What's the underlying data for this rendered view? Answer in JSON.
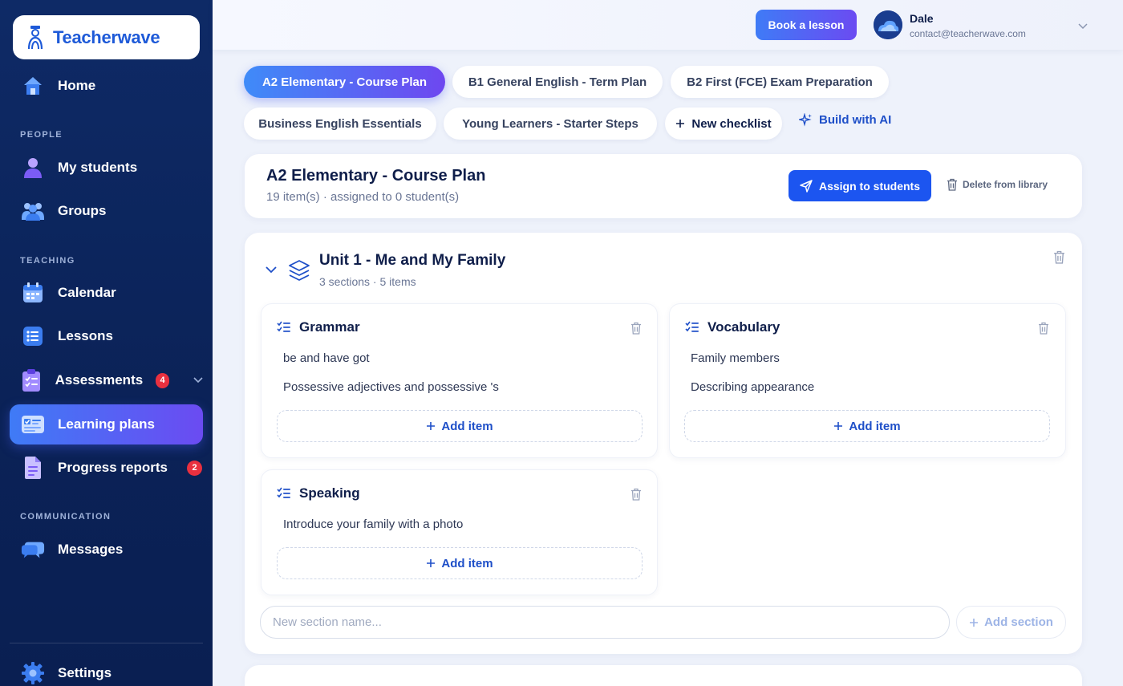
{
  "brand": {
    "name": "Teacherwave"
  },
  "sidebar": {
    "home": "Home",
    "sections": {
      "people": "PEOPLE",
      "teaching": "TEACHING",
      "communication": "COMMUNICATION"
    },
    "items": [
      {
        "label": "My students"
      },
      {
        "label": "Groups"
      },
      {
        "label": "Calendar"
      },
      {
        "label": "Lessons"
      },
      {
        "label": "Assessments",
        "badge": "4"
      },
      {
        "label": "Learning plans",
        "active": true
      },
      {
        "label": "Progress reports",
        "badge": "2"
      },
      {
        "label": "Messages"
      },
      {
        "label": "Settings"
      }
    ]
  },
  "topbar": {
    "book_label": "Book a lesson",
    "user_name": "Dale",
    "user_email": "contact@teacherwave.com"
  },
  "tabs": [
    "A2 Elementary - Course Plan",
    "B1 General English - Term Plan",
    "B2 First (FCE) Exam Preparation",
    "Business English Essentials",
    "Young Learners - Starter Steps"
  ],
  "tab_actions": {
    "new_checklist": "New checklist",
    "build_ai": "Build with AI"
  },
  "plan": {
    "title": "A2 Elementary - Course Plan",
    "meta": "19 item(s) · assigned to 0 student(s)",
    "assign_label": "Assign to students",
    "delete_label": "Delete from library"
  },
  "unit": {
    "title": "Unit 1 - Me and My Family",
    "meta": "3 sections · 5 items",
    "sections": [
      {
        "title": "Grammar",
        "items": [
          "be and have got",
          "Possessive adjectives and possessive 's"
        ]
      },
      {
        "title": "Vocabulary",
        "items": [
          "Family members",
          "Describing appearance"
        ]
      },
      {
        "title": "Speaking",
        "items": [
          "Introduce your family with a photo"
        ]
      }
    ],
    "add_item_label": "Add item",
    "new_section_placeholder": "New section name...",
    "add_section_label": "Add section"
  },
  "colors": {
    "primary": "#1c55f0",
    "sidebar": "#0e2a66",
    "accent_gradient_start": "#3f7bf6",
    "accent_gradient_end": "#6b4bf2",
    "badge": "#e9303f"
  }
}
